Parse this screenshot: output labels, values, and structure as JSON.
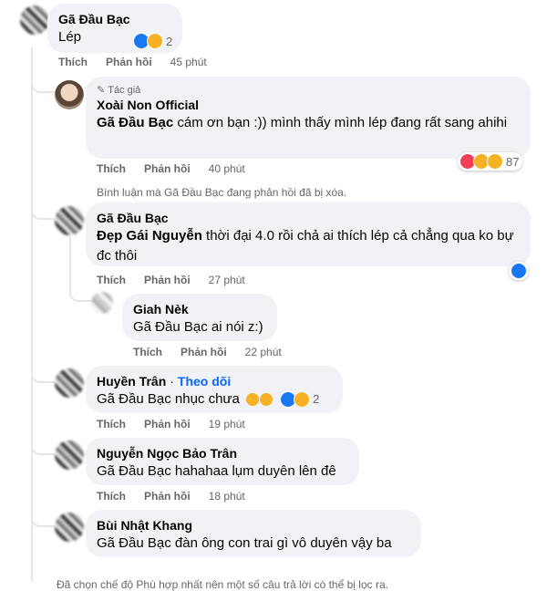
{
  "actions": {
    "like": "Thích",
    "reply": "Phản hồi"
  },
  "comments": [
    {
      "author": "Gã Đầu Bạc",
      "text": "Lép",
      "time": "45 phút",
      "reaction_count": "2"
    },
    {
      "badge": "Tác giả",
      "author": "Xoài Non Official",
      "tag": "Gã Đầu Bạc",
      "text": " cám ơn bạn :)) mình thấy mình lép đang rất sang ahihi",
      "time": "40 phút",
      "reaction_count": "87"
    },
    {
      "author": "Gã Đầu Bạc",
      "tag": "Đẹp Gái Nguyễn",
      "text": " thời đại 4.0 rồi chả ai thích lép cả chẳng qua ko bự đc thôi",
      "time": "27 phút"
    },
    {
      "author": "Giah Nèk",
      "tag": "Gã Đầu Bạc",
      "text": " ai nói z:)",
      "time": "22 phút"
    },
    {
      "author": "Huyền Trân",
      "follow": "Theo dõi",
      "tag": "Gã Đầu Bạc",
      "text": " nhục chưa",
      "time": "19 phút",
      "reaction_count": "2"
    },
    {
      "author": "Nguyễn Ngọc Bảo Trân",
      "tag": "Gã Đầu Bạc",
      "text": " hahahaa lụm duyên lên đê",
      "time": "18 phút"
    },
    {
      "author": "Bùi Nhật Khang",
      "tag": "Gã Đầu Bạc",
      "text": " đàn ông con trai gì vô duyên vậy ba",
      "time": "18 phút"
    }
  ],
  "deleted_notice": "Bình luận mà Gã Đầu Bạc đang phản hồi đã bị xóa.",
  "footer_note": "Đã chọn chế độ Phù hợp nhất nên một số câu trả lời có thể bị lọc ra.",
  "colors": {
    "link": "#0866ff",
    "like": "#1877f2",
    "haha": "#f7b125",
    "love": "#f33e58",
    "bubble": "#f0f2f5",
    "muted": "#65676b"
  }
}
